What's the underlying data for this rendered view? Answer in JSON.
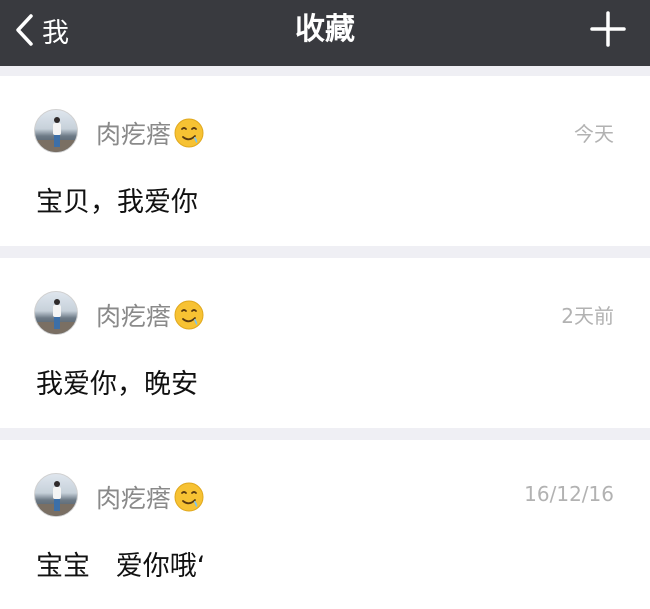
{
  "navbar": {
    "back_label": "我",
    "title": "收藏"
  },
  "favorites": [
    {
      "username": "肉疙瘩",
      "time": "今天",
      "message": "宝贝，我爱你"
    },
    {
      "username": "肉疙瘩",
      "time": "2天前",
      "message": "我爱你，晚安"
    },
    {
      "username": "肉疙瘩",
      "time": "16/12/16",
      "message": "宝宝   爱你哦‘"
    }
  ],
  "icons": {
    "back": "chevron-left-icon",
    "add": "plus-icon",
    "emoji": "drooling-face-emoji"
  },
  "colors": {
    "navbar": "#393a3f",
    "background": "#efeff4",
    "username": "#8a8a8a",
    "time": "#b2b2b2"
  }
}
